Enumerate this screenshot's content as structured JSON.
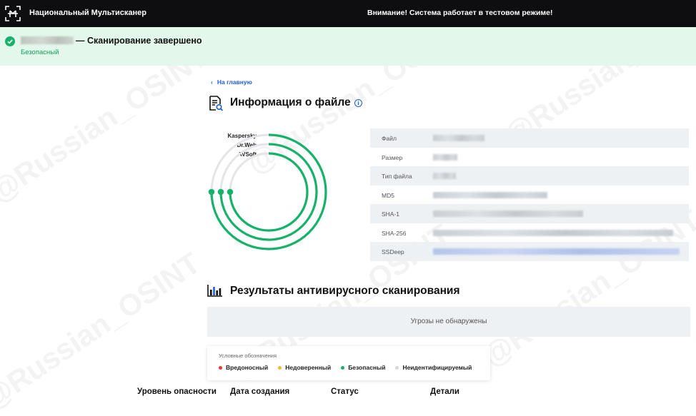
{
  "header": {
    "app_title": "Национальный Мультисканер",
    "warning": "Внимание! Система работает в тестовом режиме!"
  },
  "banner": {
    "scan_status": "— Сканирование завершено",
    "verdict": "Безопасный"
  },
  "nav": {
    "back_label": "На главную"
  },
  "file_info": {
    "title": "Информация о файле",
    "engines": [
      "Kaspersky",
      "Dr.Web",
      "AVSoft"
    ],
    "fields": [
      {
        "label": "Файл"
      },
      {
        "label": "Размер"
      },
      {
        "label": "Тип файла"
      },
      {
        "label": "MD5"
      },
      {
        "label": "SHA-1"
      },
      {
        "label": "SHA-256"
      },
      {
        "label": "SSDeep"
      }
    ]
  },
  "results": {
    "title": "Результаты антивирусного сканирования",
    "empty_text": "Угрозы не обнаружены"
  },
  "legend": {
    "title": "Условные обозначения",
    "items": [
      {
        "label": "Вредоносный",
        "color": "#e53935"
      },
      {
        "label": "Недоверенный",
        "color": "#f5b82e"
      },
      {
        "label": "Безопасный",
        "color": "#17b26a"
      },
      {
        "label": "Неидентифицируемый",
        "color": "#d5d8dc"
      }
    ]
  },
  "table_headers": [
    "Уровень опасности",
    "Дата создания",
    "Статус",
    "Детали"
  ],
  "watermark": "@Russian_OSINT",
  "colors": {
    "safe": "#17b26a",
    "link": "#1f5fd6",
    "topbar": "#0e0e10",
    "banner": "#e3f8ea"
  }
}
